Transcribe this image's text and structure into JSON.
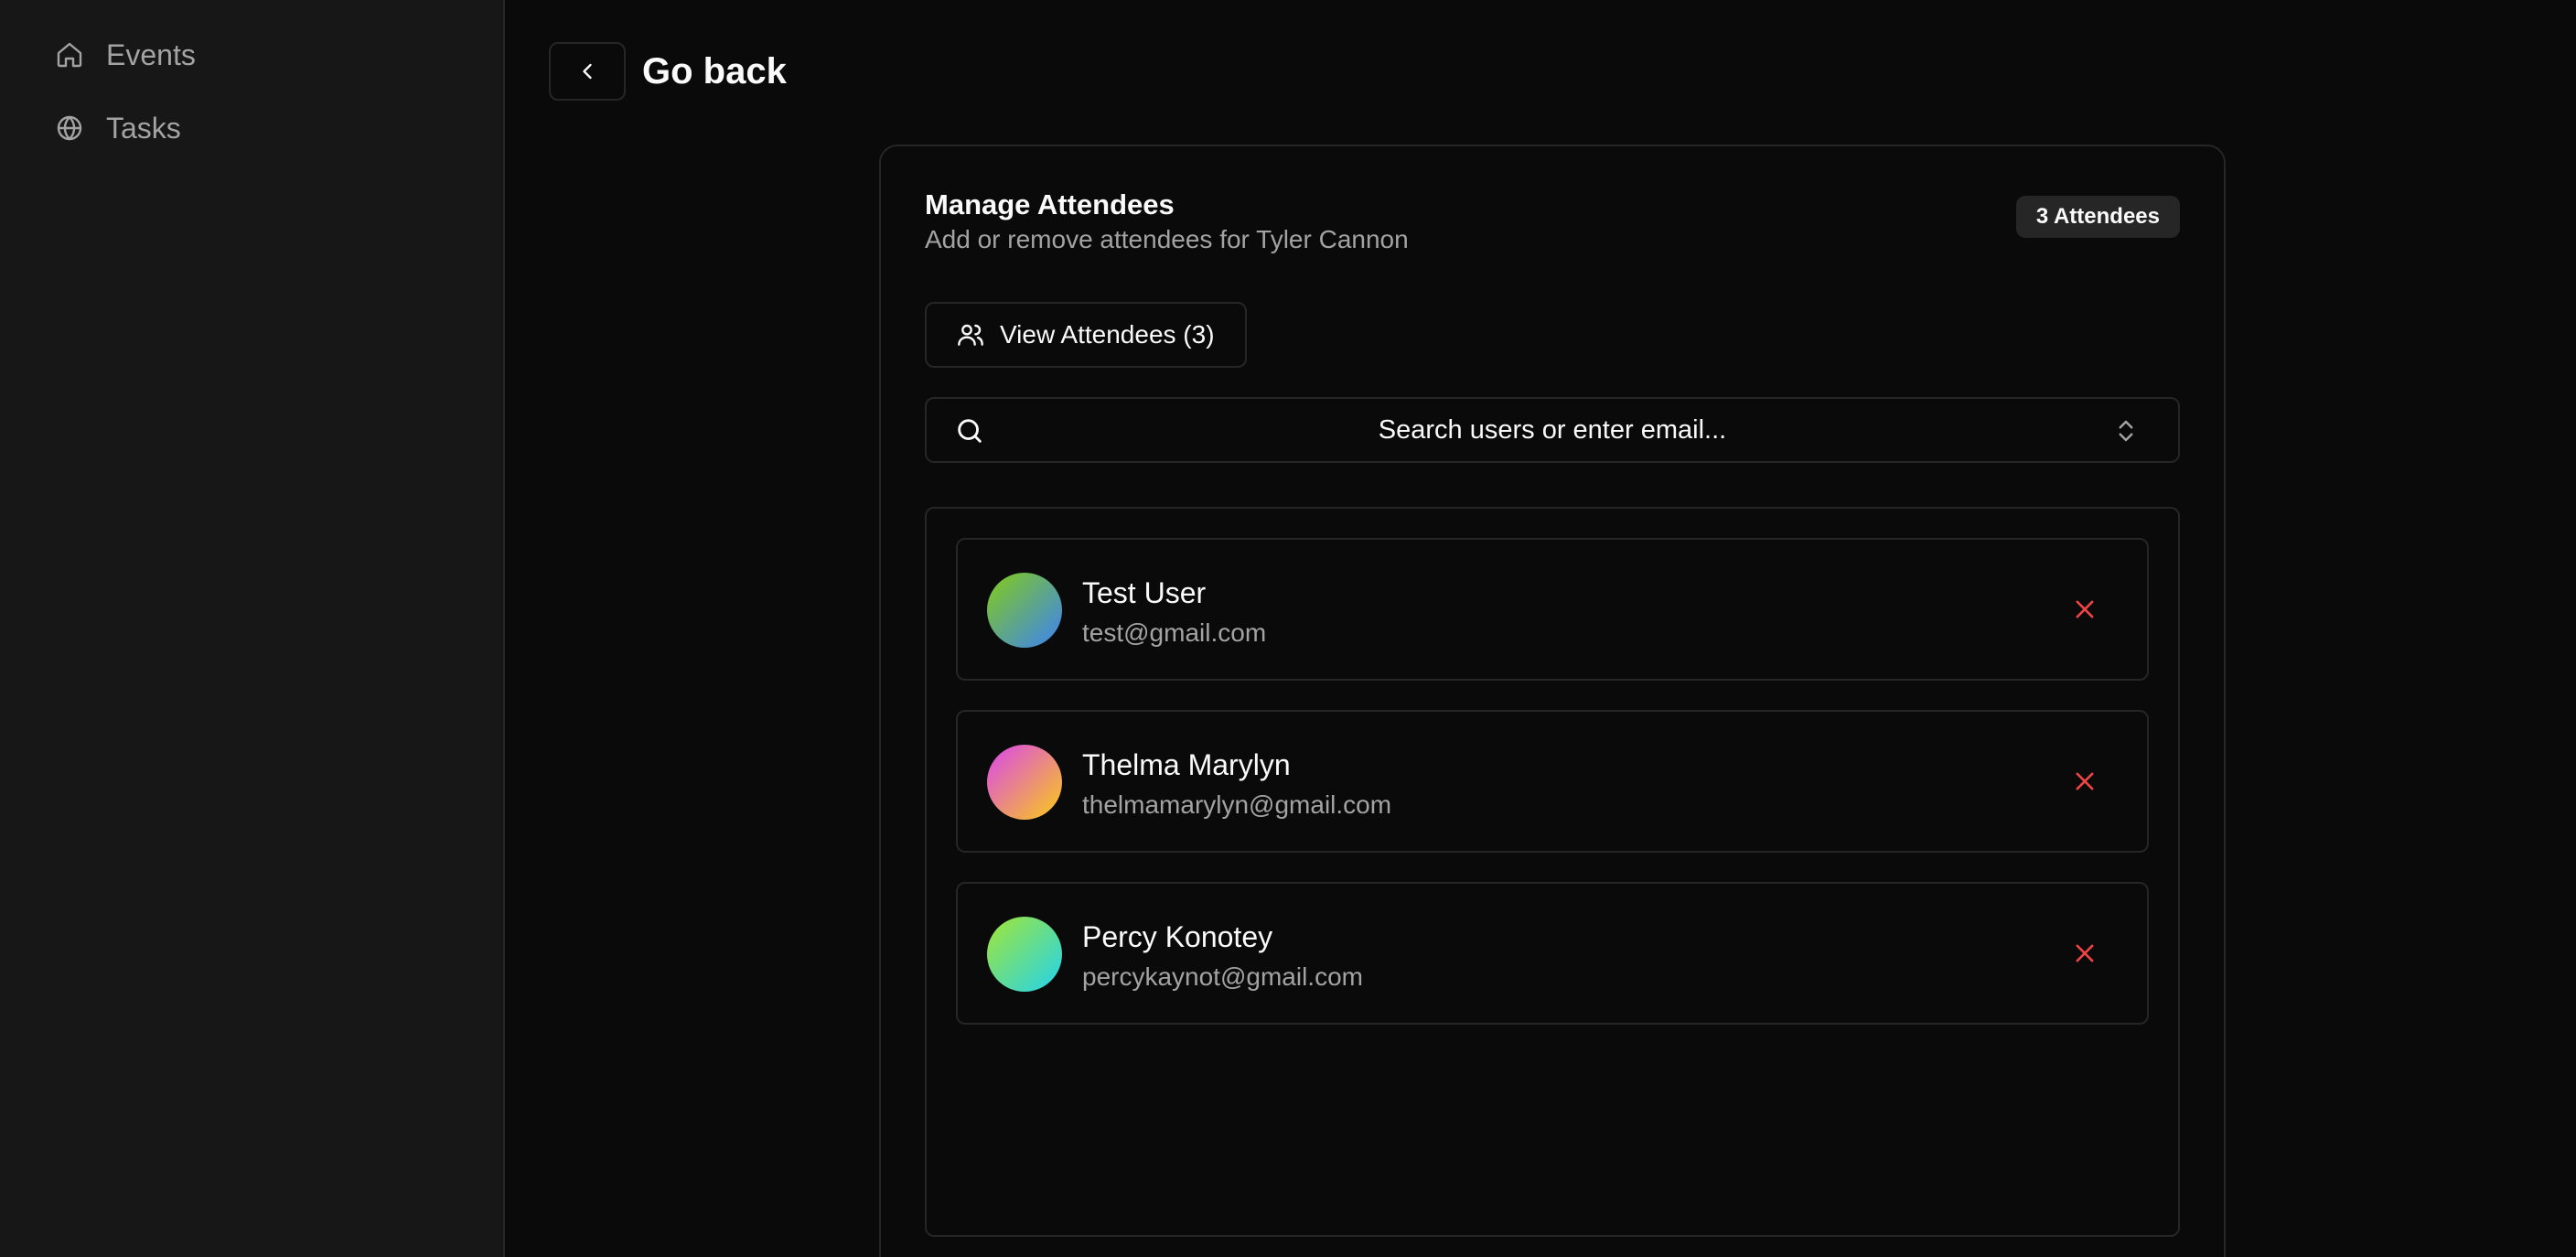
{
  "sidebar": {
    "items": [
      {
        "label": "Events",
        "icon": "home-icon"
      },
      {
        "label": "Tasks",
        "icon": "globe-icon"
      }
    ]
  },
  "header": {
    "back_icon": "chevron-left-icon",
    "title": "Go back"
  },
  "card": {
    "title": "Manage Attendees",
    "subtitle": "Add or remove attendees for Tyler Cannon",
    "count_badge": "3 Attendees",
    "view_button": {
      "label": "View Attendees (3)",
      "icon": "users-icon"
    },
    "search": {
      "placeholder": "Search users or enter email...",
      "value": "",
      "icon": "search-icon",
      "trailing_icon": "chevrons-up-down-icon"
    }
  },
  "attendees": [
    {
      "name": "Test User",
      "email": "test@gmail.com",
      "avatar_from": "#84cc16",
      "avatar_to": "#3b82f6"
    },
    {
      "name": "Thelma Marylyn",
      "email": "thelmamarylyn@gmail.com",
      "avatar_from": "#d946ef",
      "avatar_to": "#facc15"
    },
    {
      "name": "Percy Konotey",
      "email": "percykaynot@gmail.com",
      "avatar_from": "#a3e635",
      "avatar_to": "#22d3ee"
    }
  ],
  "colors": {
    "background": "#0a0a0a",
    "sidebar": "#171717",
    "border": "#262626",
    "remove": "#ef4444",
    "muted_text": "#a3a3a3"
  }
}
